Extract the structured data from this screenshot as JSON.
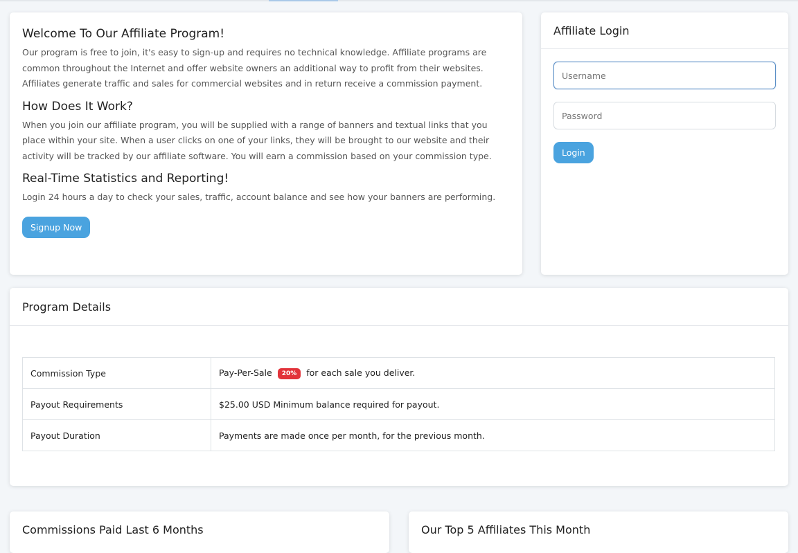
{
  "welcome": {
    "title1": "Welcome To Our Affiliate Program!",
    "para1": "Our program is free to join, it's easy to sign-up and requires no technical knowledge. Affiliate programs are common throughout the Internet and offer website owners an additional way to profit from their websites. Affiliates generate traffic and sales for commercial websites and in return receive a commission payment.",
    "title2": "How Does It Work?",
    "para2": "When you join our affiliate program, you will be supplied with a range of banners and textual links that you place within your site. When a user clicks on one of your links, they will be brought to our website and their activity will be tracked by our affiliate software. You will earn a commission based on your commission type.",
    "title3": "Real-Time Statistics and Reporting!",
    "para3": "Login 24 hours a day to check your sales, traffic, account balance and see how your banners are performing.",
    "signup_label": "Signup Now"
  },
  "login": {
    "title": "Affiliate Login",
    "username_placeholder": "Username",
    "password_placeholder": "Password",
    "login_label": "Login"
  },
  "program": {
    "title": "Program Details",
    "rows": [
      {
        "label": "Commission Type",
        "pre": "Pay-Per-Sale",
        "badge": "20%",
        "post": "for each sale you deliver."
      },
      {
        "label": "Payout Requirements",
        "value": "$25.00 USD Minimum balance required for payout."
      },
      {
        "label": "Payout Duration",
        "value": "Payments are made once per month, for the previous month."
      }
    ]
  },
  "commissions": {
    "title": "Commissions Paid Last 6 Months"
  },
  "top5": {
    "title": "Our Top 5 Affiliates This Month"
  },
  "colors": {
    "accent": "#4aa3df",
    "badge": "#e2333a",
    "background": "#f3f6f9"
  }
}
